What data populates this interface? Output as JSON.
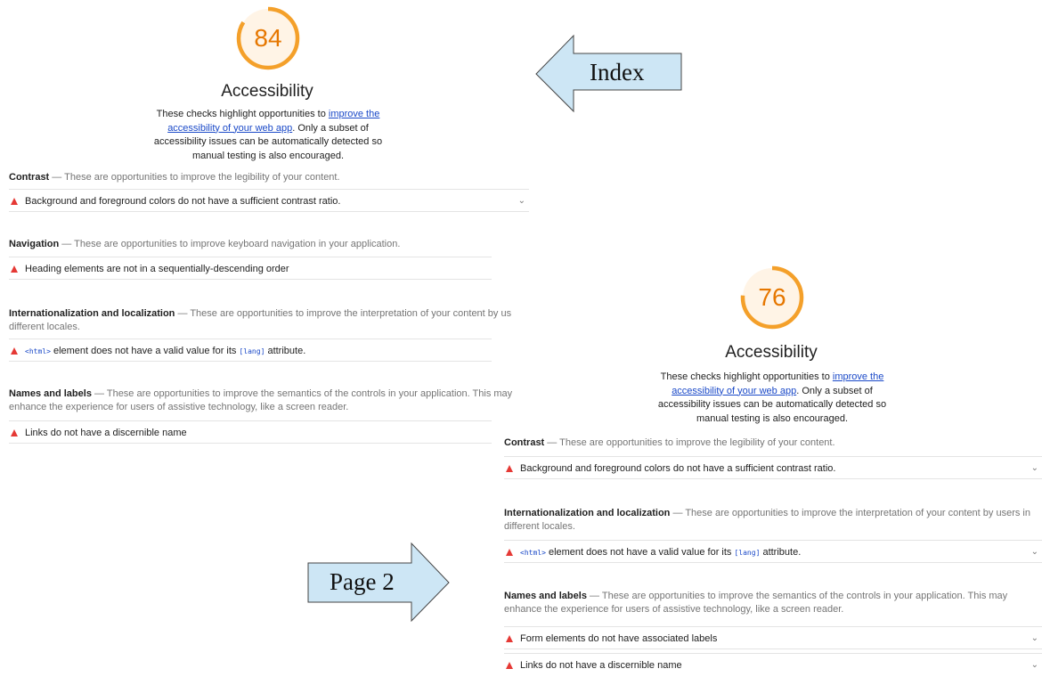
{
  "index_label": "Index",
  "page2_label": "Page 2",
  "report_index": {
    "score": "84",
    "title": "Accessibility",
    "desc_before": "These checks highlight opportunities to ",
    "desc_link": "improve the accessibility of your web app",
    "desc_after": ". Only a subset of accessibility issues can be automatically detected so manual testing is also encouraged.",
    "groups": [
      {
        "name": "Contrast",
        "desc": " — These are opportunities to improve the legibility of your content."
      },
      {
        "name": "Navigation",
        "desc": " — These are opportunities to improve keyboard navigation in your application."
      },
      {
        "name": "Internationalization and localization",
        "desc": " — These are opportunities to improve the interpretation of your content by us"
      },
      {
        "name": "Names and labels",
        "desc": " — These are opportunities to improve the semantics of the controls in your application. This may"
      }
    ],
    "group3_line2": "different locales.",
    "group4_line2": "enhance the experience for users of assistive technology, like a screen reader.",
    "audits": [
      "Background and foreground colors do not have a sufficient contrast ratio.",
      "Heading elements are not in a sequentially-descending order",
      "Links do not have a discernible name"
    ],
    "lang_audit": {
      "code1": "<html>",
      "mid": " element does not have a valid value for its ",
      "code2": "[lang]",
      "end": " attribute."
    }
  },
  "report_page2": {
    "score": "76",
    "title": "Accessibility",
    "desc_before": "These checks highlight opportunities to ",
    "desc_link": "improve the accessibility of your web app",
    "desc_after": ". Only a subset of accessibility issues can be automatically detected so manual testing is also encouraged.",
    "groups": [
      {
        "name": "Contrast",
        "desc": " — These are opportunities to improve the legibility of your content."
      },
      {
        "name": "Internationalization and localization",
        "desc": " — These are opportunities to improve the interpretation of your content by users in"
      },
      {
        "name": "Names and labels",
        "desc": " — These are opportunities to improve the semantics of the controls in your application. This may"
      }
    ],
    "group2_line2": "different locales.",
    "group3_line2": "enhance the experience for users of assistive technology, like a screen reader.",
    "audits": [
      "Background and foreground colors do not have a sufficient contrast ratio.",
      "Form elements do not have associated labels",
      "Links do not have a discernible name"
    ],
    "lang_audit": {
      "code1": "<html>",
      "mid": " element does not have a valid value for its ",
      "code2": "[lang]",
      "end": " attribute."
    }
  },
  "colors": {
    "gauge_stroke": "#f4a02a",
    "gauge_fill": "#fff4e6",
    "score_text": "#e67700",
    "fail_icon": "#e53935",
    "arrow_fill": "#cde6f5"
  }
}
